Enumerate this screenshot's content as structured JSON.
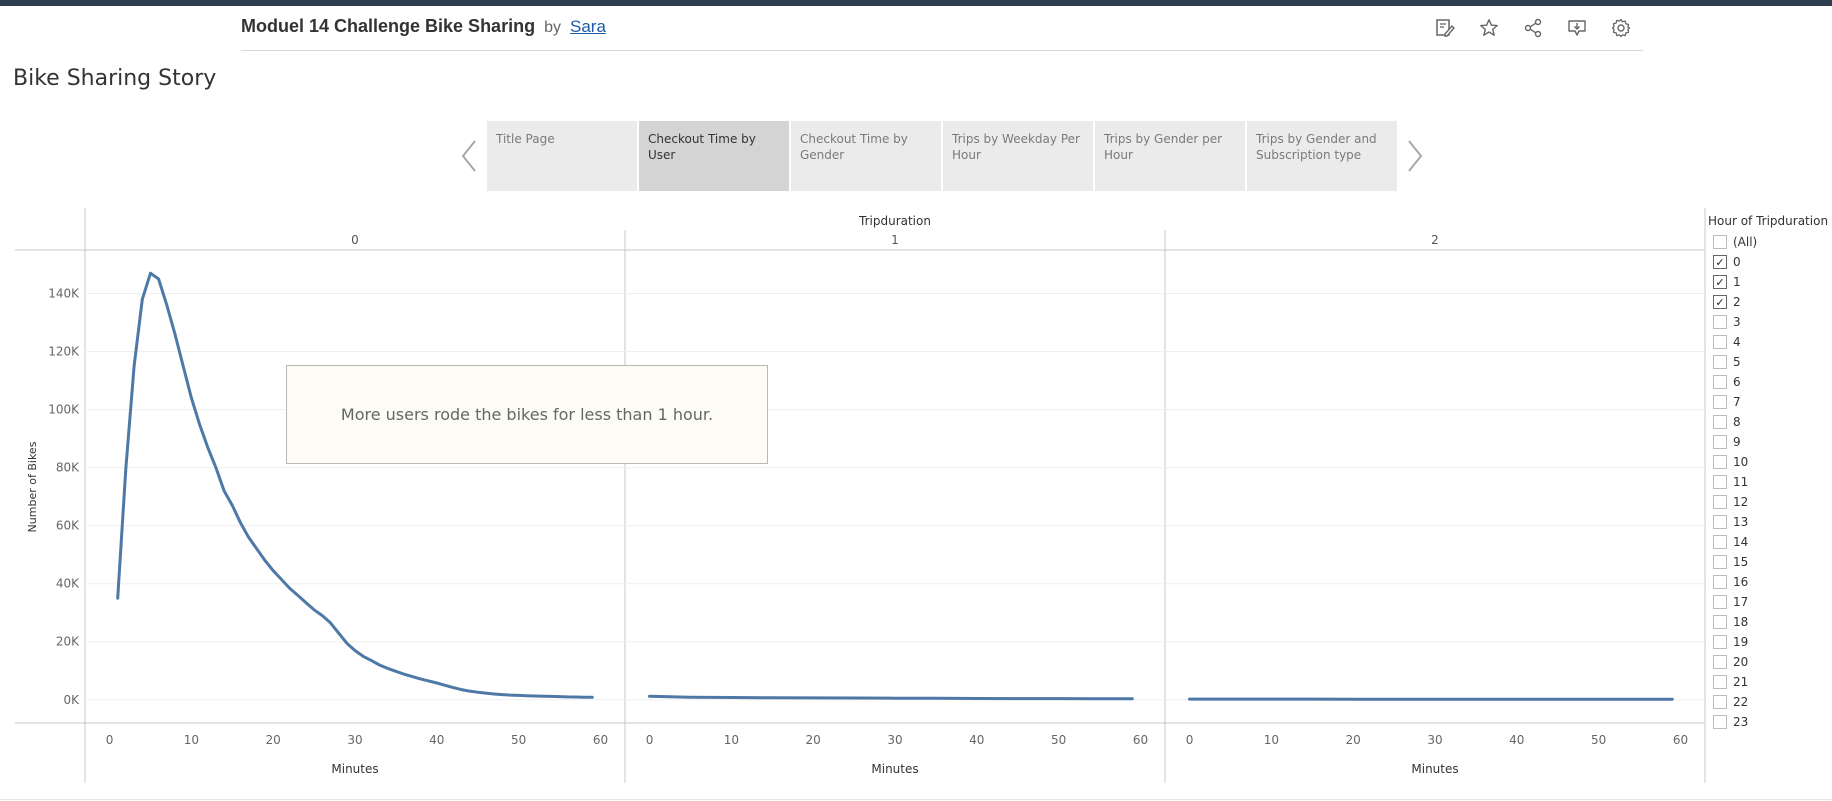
{
  "header": {
    "workbook_title": "Moduel 14 Challenge Bike Sharing",
    "by_label": "by",
    "author": "Sara",
    "icons": [
      "edit-icon",
      "favorite-star-icon",
      "share-icon",
      "download-icon",
      "settings-gear-icon"
    ]
  },
  "story": {
    "title": "Bike Sharing Story",
    "points": [
      {
        "label": "Title Page",
        "active": false
      },
      {
        "label": "Checkout Time by User",
        "active": true
      },
      {
        "label": "Checkout Time by Gender",
        "active": false
      },
      {
        "label": "Trips by Weekday Per Hour",
        "active": false
      },
      {
        "label": "Trips by Gender per Hour",
        "active": false
      },
      {
        "label": "Trips by Gender and Subscription type",
        "active": false
      }
    ]
  },
  "annotation": {
    "text": "More users rode the bikes for less than 1 hour."
  },
  "filter": {
    "title": "Hour of Tripduration",
    "items": [
      {
        "label": "(All)",
        "checked": false
      },
      {
        "label": "0",
        "checked": true
      },
      {
        "label": "1",
        "checked": true
      },
      {
        "label": "2",
        "checked": true
      },
      {
        "label": "3",
        "checked": false
      },
      {
        "label": "4",
        "checked": false
      },
      {
        "label": "5",
        "checked": false
      },
      {
        "label": "6",
        "checked": false
      },
      {
        "label": "7",
        "checked": false
      },
      {
        "label": "8",
        "checked": false
      },
      {
        "label": "9",
        "checked": false
      },
      {
        "label": "10",
        "checked": false
      },
      {
        "label": "11",
        "checked": false
      },
      {
        "label": "12",
        "checked": false
      },
      {
        "label": "13",
        "checked": false
      },
      {
        "label": "14",
        "checked": false
      },
      {
        "label": "15",
        "checked": false
      },
      {
        "label": "16",
        "checked": false
      },
      {
        "label": "17",
        "checked": false
      },
      {
        "label": "18",
        "checked": false
      },
      {
        "label": "19",
        "checked": false
      },
      {
        "label": "20",
        "checked": false
      },
      {
        "label": "21",
        "checked": false
      },
      {
        "label": "22",
        "checked": false
      },
      {
        "label": "23",
        "checked": false
      }
    ]
  },
  "colors": {
    "line": "#4e79a7",
    "topbar": "#2d3e50"
  },
  "chart_data": {
    "type": "line",
    "column_header": "Tripduration",
    "ylabel": "Number of Bikes",
    "xlabel": "Minutes",
    "yticks": [
      "0K",
      "20K",
      "40K",
      "60K",
      "80K",
      "100K",
      "120K",
      "140K"
    ],
    "ylim": [
      -8000,
      155000
    ],
    "xticks": [
      0,
      10,
      20,
      30,
      40,
      50,
      60
    ],
    "xlim": [
      -3,
      63
    ],
    "panels": [
      {
        "name": "0",
        "x": [
          1,
          2,
          3,
          4,
          5,
          6,
          7,
          8,
          9,
          10,
          11,
          12,
          13,
          14,
          15,
          16,
          17,
          18,
          19,
          20,
          21,
          22,
          23,
          24,
          25,
          26,
          27,
          28,
          29,
          30,
          31,
          32,
          33,
          34,
          35,
          36,
          37,
          38,
          39,
          40,
          41,
          42,
          43,
          44,
          45,
          46,
          47,
          48,
          49,
          50,
          51,
          52,
          53,
          54,
          55,
          56,
          57,
          58,
          59
        ],
        "y": [
          35000,
          80000,
          115000,
          138000,
          147000,
          145000,
          136000,
          126000,
          115000,
          104000,
          95000,
          87000,
          80000,
          72000,
          67000,
          61000,
          56000,
          52000,
          48000,
          44500,
          41500,
          38500,
          36000,
          33500,
          31000,
          29000,
          26500,
          23000,
          19500,
          17000,
          15000,
          13500,
          12000,
          10800,
          9800,
          8800,
          8000,
          7200,
          6500,
          5800,
          5000,
          4200,
          3500,
          3000,
          2600,
          2300,
          2000,
          1800,
          1600,
          1500,
          1400,
          1300,
          1250,
          1150,
          1100,
          1000,
          950,
          900,
          850
        ]
      },
      {
        "name": "1",
        "x": [
          0,
          5,
          10,
          15,
          20,
          25,
          30,
          35,
          40,
          45,
          50,
          55,
          59
        ],
        "y": [
          1200,
          900,
          800,
          700,
          650,
          600,
          550,
          500,
          450,
          420,
          400,
          380,
          350
        ]
      },
      {
        "name": "2",
        "x": [
          0,
          5,
          10,
          15,
          20,
          25,
          30,
          35,
          40,
          45,
          50,
          55,
          59
        ],
        "y": [
          250,
          240,
          230,
          220,
          210,
          200,
          190,
          185,
          180,
          175,
          170,
          165,
          160
        ]
      }
    ]
  }
}
